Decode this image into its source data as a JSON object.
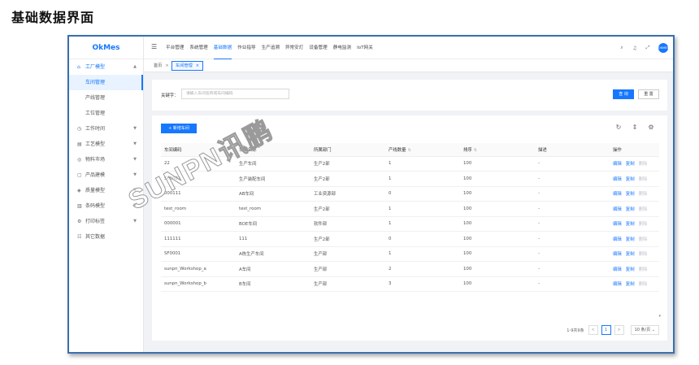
{
  "page_heading": "基础数据界面",
  "app": {
    "name": "OkMes"
  },
  "sidebar": {
    "groups": [
      {
        "icon": "factory-icon",
        "glyph": "⌂",
        "label": "工厂模型",
        "expanded": true,
        "children": [
          {
            "label": "车间管理",
            "selected": true
          },
          {
            "label": "产线管理"
          },
          {
            "label": "工位管理"
          }
        ]
      },
      {
        "icon": "clock-icon",
        "glyph": "◷",
        "label": "工作时间"
      },
      {
        "icon": "process-icon",
        "glyph": "▤",
        "label": "工艺模型"
      },
      {
        "icon": "material-icon",
        "glyph": "◎",
        "label": "物料市场"
      },
      {
        "icon": "product-icon",
        "glyph": "▢",
        "label": "产品建模"
      },
      {
        "icon": "quality-icon",
        "glyph": "◈",
        "label": "质量模型"
      },
      {
        "icon": "barcode-icon",
        "glyph": "▥",
        "label": "条码模型"
      },
      {
        "icon": "print-icon",
        "glyph": "⚙",
        "label": "打印标签"
      },
      {
        "icon": "other-data-icon",
        "glyph": "☷",
        "label": "其它数据"
      }
    ]
  },
  "topnav": {
    "items": [
      "平台管理",
      "系统管理",
      "基础数据",
      "作业指导",
      "生产追溯",
      "异常安灯",
      "设备管理",
      "静电监测",
      "IoT网关"
    ],
    "active_index": 2
  },
  "top_icons": {
    "search": "⌕",
    "bell": "♫",
    "fullscreen": "⤢",
    "avatar_text": "OKMES"
  },
  "tabs": [
    {
      "label": "首页",
      "active": false
    },
    {
      "label": "车间管理",
      "active": true
    }
  ],
  "search": {
    "label": "关键字：",
    "placeholder": "请输入车间名称或车间编码",
    "query_button": "查 询",
    "reset_button": "重 置"
  },
  "table": {
    "add_button": "+ 新增车间",
    "tool_glyphs": {
      "refresh": "↻",
      "density": "⇕",
      "settings": "⚙"
    },
    "columns": [
      {
        "label": "车间编码",
        "sortable": false
      },
      {
        "label": "车间名称",
        "sortable": false
      },
      {
        "label": "所属部门",
        "sortable": false
      },
      {
        "label": "产线数量",
        "sortable": true
      },
      {
        "label": "排序",
        "sortable": true
      },
      {
        "label": "描述",
        "sortable": false
      },
      {
        "label": "操作",
        "sortable": false
      }
    ],
    "actions": [
      "编辑",
      "复制",
      "删除"
    ],
    "rows": [
      {
        "code": "22",
        "name": "生产车间",
        "dept": "生产2部",
        "lines": "1",
        "sort": "100",
        "desc": "-"
      },
      {
        "code": "SF0002",
        "name": "生产装配车间",
        "dept": "生产2部",
        "lines": "1",
        "sort": "100",
        "desc": "-"
      },
      {
        "code": "000111",
        "name": "AB车间",
        "dept": "工业资源部",
        "lines": "0",
        "sort": "100",
        "desc": "-"
      },
      {
        "code": "test_room",
        "name": "test_room",
        "dept": "生产2部",
        "lines": "1",
        "sort": "100",
        "desc": "-"
      },
      {
        "code": "000001",
        "name": "BOE车间",
        "dept": "软件部",
        "lines": "1",
        "sort": "100",
        "desc": "-"
      },
      {
        "code": "111111",
        "name": "111",
        "dept": "生产2部",
        "lines": "0",
        "sort": "100",
        "desc": "-"
      },
      {
        "code": "SF0001",
        "name": "A栋生产车间",
        "dept": "生产部",
        "lines": "1",
        "sort": "100",
        "desc": "-"
      },
      {
        "code": "sunpn_Workshop_a",
        "name": "A车间",
        "dept": "生产部",
        "lines": "2",
        "sort": "100",
        "desc": "-"
      },
      {
        "code": "sunpn_Workshop_b",
        "name": "B车间",
        "dept": "生产部",
        "lines": "3",
        "sort": "100",
        "desc": "-"
      }
    ]
  },
  "pagination": {
    "total": "1-9共9条",
    "prev": "<",
    "current": "1",
    "next": ">",
    "page_size": "10 条/页 ⌄"
  },
  "watermark": "SUNPN讯鹏",
  "colors": {
    "primary": "#1677ff",
    "frame_border": "#3a6fb0",
    "page_bg": "#f0f2f5"
  }
}
